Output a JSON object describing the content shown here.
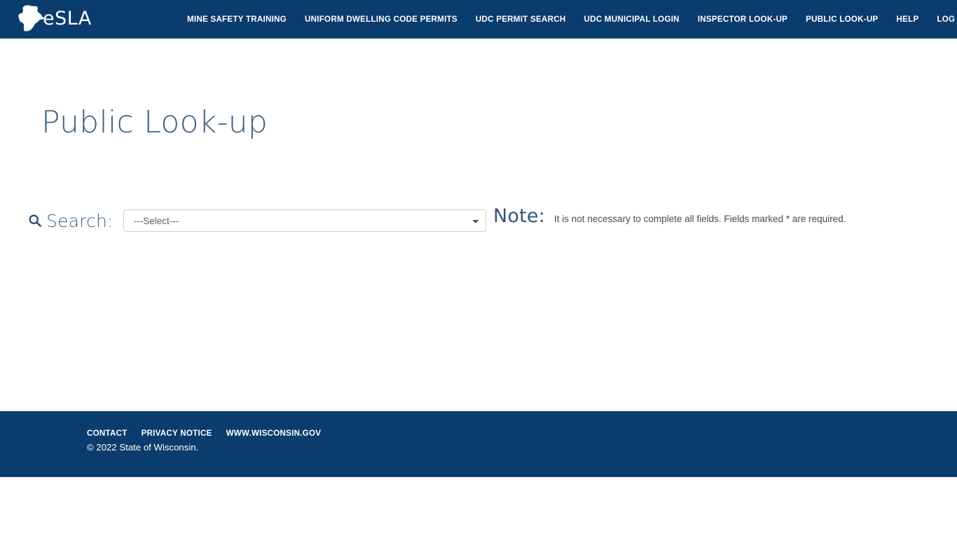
{
  "header": {
    "brand": {
      "word": "eSLA",
      "mark_name": "wisconsin-state-outline"
    },
    "nav": [
      {
        "label": "MINE SAFETY TRAINING",
        "name": "nav-mine-safety-training"
      },
      {
        "label": "UNIFORM DWELLING CODE PERMITS",
        "name": "nav-uniform-dwelling-code-permits"
      },
      {
        "label": "UDC PERMIT SEARCH",
        "name": "nav-udc-permit-search"
      },
      {
        "label": "UDC MUNICIPAL LOGIN",
        "name": "nav-udc-municipal-login"
      },
      {
        "label": "INSPECTOR LOOK-UP",
        "name": "nav-inspector-look-up"
      },
      {
        "label": "PUBLIC LOOK-UP",
        "name": "nav-public-look-up"
      },
      {
        "label": "HELP",
        "name": "nav-help"
      },
      {
        "label": "LOG IN",
        "name": "nav-log-in"
      }
    ]
  },
  "main": {
    "page_title": "Public Look-up",
    "search": {
      "icon": "search-icon",
      "label": "Search:",
      "selected_value": "---Select---",
      "options": [
        "---Select---"
      ]
    },
    "note": {
      "label": "Note:",
      "text": "It is not necessary to complete all fields. Fields marked * are required."
    }
  },
  "footer": {
    "links": [
      {
        "label": "CONTACT",
        "name": "footer-link-contact"
      },
      {
        "label": "PRIVACY NOTICE",
        "name": "footer-link-privacy-notice"
      },
      {
        "label": "WWW.WISCONSIN.GOV",
        "name": "footer-link-wisconsin-gov"
      }
    ],
    "copyright": "© 2022 State of Wisconsin."
  },
  "colors": {
    "header_blue": "#0b3c6e",
    "title_slate": "#3f6183",
    "note_blue": "#34557a",
    "body_text": "#4a4a4a",
    "select_border": "#cfcfcf"
  }
}
